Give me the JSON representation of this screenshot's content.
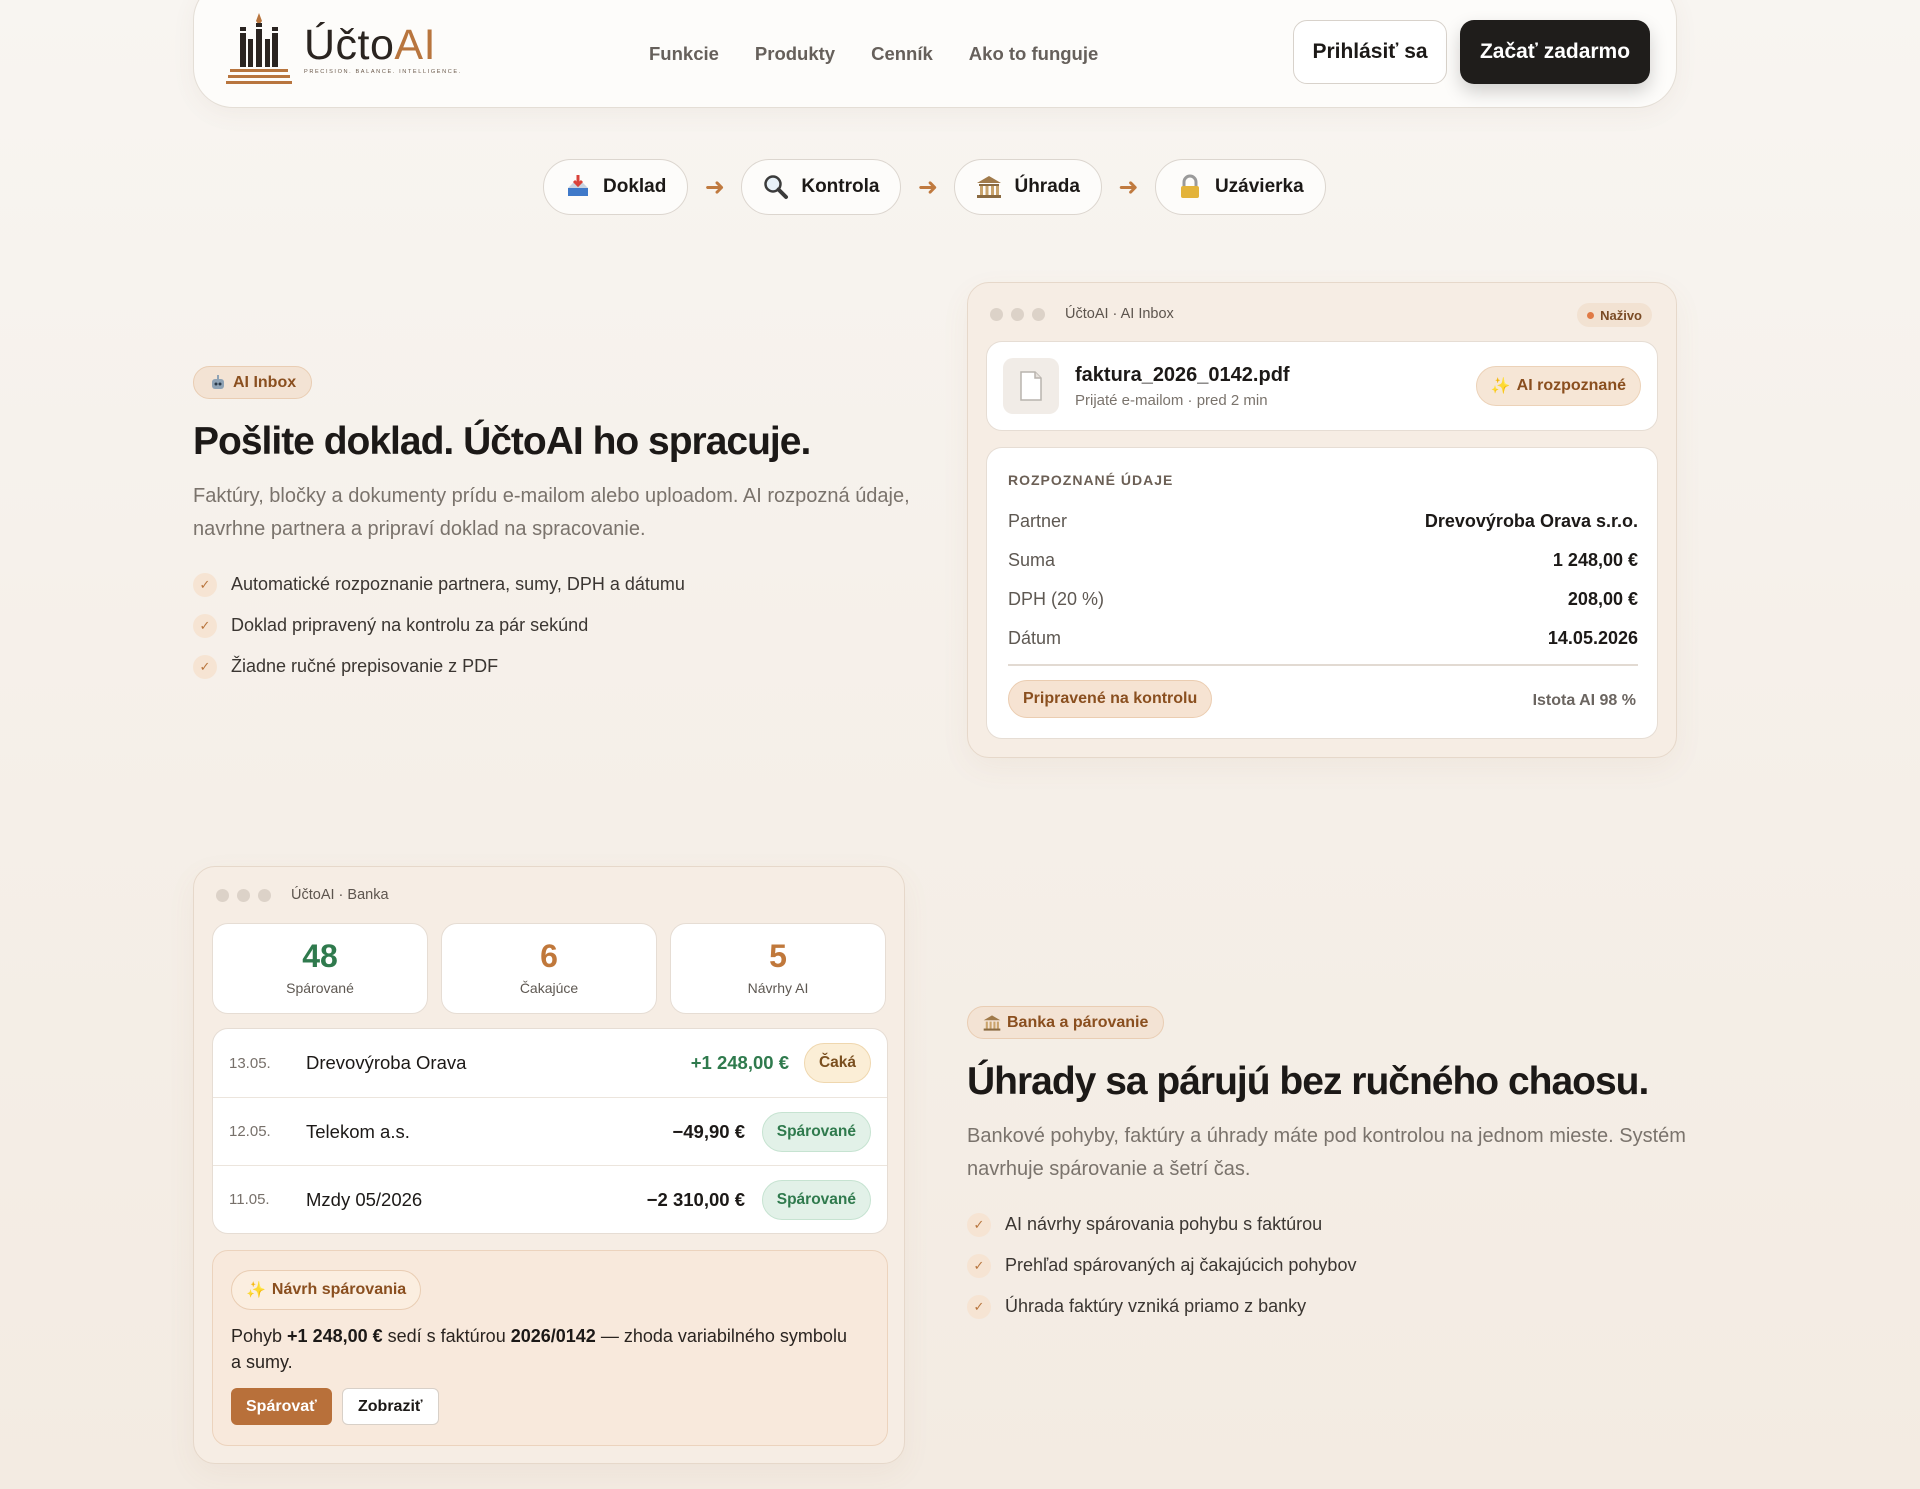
{
  "nav": {
    "logo_text_main": "Účto",
    "logo_text_accent": "AI",
    "logo_tagline": "PRECISION. BALANCE. INTELLIGENCE.",
    "links": [
      "Funkcie",
      "Produkty",
      "Cenník",
      "Ako to funguje"
    ],
    "login_label": "Prihlásiť sa",
    "start_label": "Začať zadarmo"
  },
  "flow": {
    "steps": [
      {
        "label": "Doklad",
        "icon": "inbox-tray-icon"
      },
      {
        "label": "Kontrola",
        "icon": "magnifier-icon"
      },
      {
        "label": "Úhrada",
        "icon": "bank-icon"
      },
      {
        "label": "Uzávierka",
        "icon": "lock-icon"
      }
    ],
    "arrow": "➜"
  },
  "section1": {
    "badge": "AI Inbox",
    "title": "Pošlite doklad. ÚčtoAI ho spracuje.",
    "description": "Faktúry, bločky a dokumenty prídu e-mailom alebo uploadom. AI rozpozná údaje, navrhne partnera a pripraví doklad na spracovanie.",
    "bullets": [
      "Automatické rozpoznanie partnera, sumy, DPH a dátumu",
      "Doklad pripravený na kontrolu za pár sekúnd",
      "Žiadne ručné prepisovanie z PDF"
    ]
  },
  "inbox_window": {
    "title": "ÚčtoAI · AI Inbox",
    "live_label": "Naživo",
    "file_name": "faktura_2026_0142.pdf",
    "file_meta": "Prijaté e-mailom · pred 2 min",
    "recognized_badge": "AI rozpoznané",
    "data_heading": "ROZPOZNANÉ ÚDAJE",
    "fields": [
      {
        "key": "Partner",
        "value": "Drevovýroba Orava s.r.o."
      },
      {
        "key": "Suma",
        "value": "1 248,00 €"
      },
      {
        "key": "DPH (20 %)",
        "value": "208,00 €"
      },
      {
        "key": "Dátum",
        "value": "14.05.2026"
      }
    ],
    "ready_label": "Pripravené na kontrolu",
    "confidence": "Istota AI 98 %"
  },
  "bank_window": {
    "title": "ÚčtoAI · Banka",
    "stats": [
      {
        "value": "48",
        "label": "Spárované"
      },
      {
        "value": "6",
        "label": "Čakajúce"
      },
      {
        "value": "5",
        "label": "Návrhy AI"
      }
    ],
    "transactions": [
      {
        "date": "13.05.",
        "name": "Drevovýroba Orava",
        "amount": "+1 248,00 €",
        "status": "Čaká"
      },
      {
        "date": "12.05.",
        "name": "Telekom a.s.",
        "amount": "−49,90 €",
        "status": "Spárované"
      },
      {
        "date": "11.05.",
        "name": "Mzdy 05/2026",
        "amount": "−2 310,00 €",
        "status": "Spárované"
      }
    ],
    "suggestion": {
      "badge": "Návrh spárovania",
      "text_1": "Pohyb ",
      "amount": "+1 248,00 €",
      "text_2": " sedí s faktúrou ",
      "invoice": "2026/0142",
      "text_3": " — zhoda variabilného symbolu a sumy.",
      "pair_label": "Spárovať",
      "show_label": "Zobraziť"
    }
  },
  "section2": {
    "badge": "Banka a párovanie",
    "title": "Úhrady sa párujú bez ručného chaosu.",
    "description": "Bankové pohyby, faktúry a úhrady máte pod kontrolou na jednom mieste. Systém navrhuje spárovanie a šetrí čas.",
    "bullets": [
      "AI návrhy spárovania pohybu s faktúrou",
      "Prehľad spárovaných aj čakajúcich pohybov",
      "Úhrada faktúry vzniká priamo z banky"
    ]
  },
  "colors": {
    "accent": "#b8753e",
    "dark_button": "#1f1d1b",
    "green": "#2f7a4d",
    "orange": "#c0783b"
  }
}
